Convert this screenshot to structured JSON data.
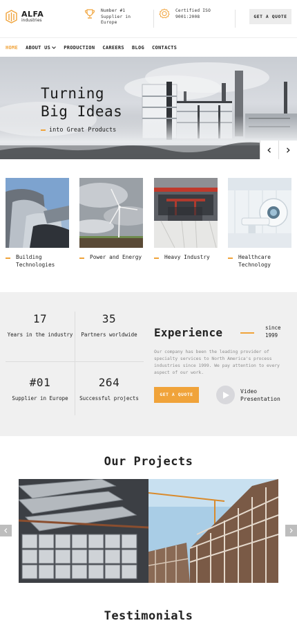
{
  "brand": {
    "name": "ALFA",
    "tagline": "industries",
    "accent": "#f0a33a"
  },
  "header": {
    "info": [
      {
        "icon": "trophy-icon",
        "text": "Number #1 Supplier in Europe"
      },
      {
        "icon": "certificate-icon",
        "text": "Certified ISO 9001:2008"
      }
    ],
    "quote_button": "GET A QUOTE"
  },
  "nav": {
    "items": [
      {
        "label": "HOME",
        "active": true
      },
      {
        "label": "ABOUT US",
        "dropdown": true
      },
      {
        "label": "PRODUCTION"
      },
      {
        "label": "CAREERS"
      },
      {
        "label": "BLOG"
      },
      {
        "label": "CONTACTS"
      }
    ]
  },
  "hero": {
    "title_line1": "Turning",
    "title_line2": "Big Ideas",
    "subtitle": "into Great Products",
    "prev_icon": "chevron-left-icon",
    "next_icon": "chevron-right-icon"
  },
  "industries": [
    {
      "label": "Building Technologies"
    },
    {
      "label": "Power and Energy"
    },
    {
      "label": "Heavy Industry"
    },
    {
      "label": "Healthcare Technology"
    }
  ],
  "stats": [
    {
      "value": "17",
      "label": "Years in the industry"
    },
    {
      "value": "35",
      "label": "Partners worldwide"
    },
    {
      "value": "#01",
      "label": "Supplier in Europe"
    },
    {
      "value": "264",
      "label": "Successful projects"
    }
  ],
  "experience": {
    "title": "Experience",
    "since": "since 1999",
    "description": "Our company has been the leading provider of specialty services to North America's process industries since 1999. We pay attention to every aspect of our work.",
    "button": "GET A QUOTE",
    "video_label": "Video Presentation"
  },
  "projects": {
    "title": "Our Projects"
  },
  "testimonials": {
    "title": "Testimonials"
  }
}
